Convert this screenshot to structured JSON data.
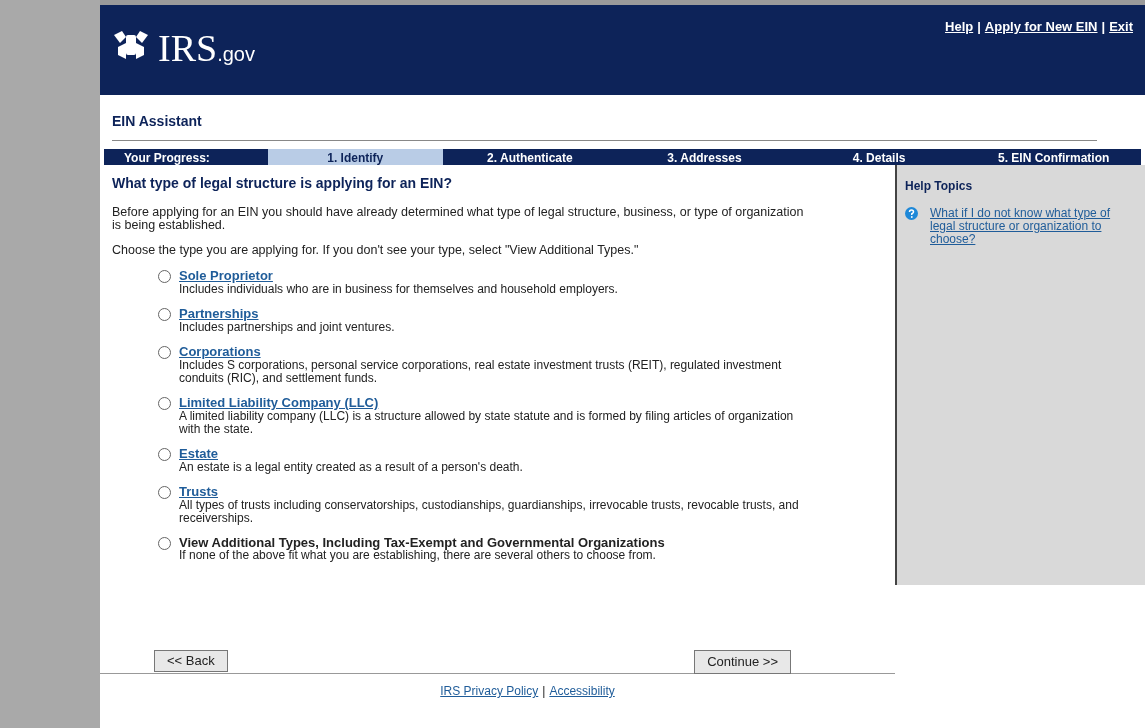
{
  "header": {
    "logo_main": "IRS",
    "logo_suffix": ".gov",
    "links": [
      {
        "label": "Help"
      },
      {
        "label": "Apply for New EIN"
      },
      {
        "label": "Exit"
      }
    ],
    "separator": "|"
  },
  "page_title": "EIN Assistant",
  "progress": {
    "label": "Your Progress:",
    "steps": [
      {
        "label": "1. Identify",
        "selected": true
      },
      {
        "label": "2. Authenticate",
        "selected": false
      },
      {
        "label": "3. Addresses",
        "selected": false
      },
      {
        "label": "4. Details",
        "selected": false
      },
      {
        "label": "5. EIN Confirmation",
        "selected": false
      }
    ]
  },
  "question": "What type of legal structure is applying for an EIN?",
  "intro": [
    "Before applying for an EIN you should have already determined what type of legal structure, business, or type of organization is being established.",
    "Choose the type you are applying for. If you don't see your type, select \"View Additional Types.\""
  ],
  "options": [
    {
      "kind": "link",
      "title": "Sole Proprietor",
      "description": "Includes individuals who are in business for themselves and household employers.",
      "selected": false
    },
    {
      "kind": "link",
      "title": "Partnerships",
      "description": "Includes partnerships and joint ventures.",
      "selected": false
    },
    {
      "kind": "link",
      "title": "Corporations",
      "description": "Includes S corporations, personal service corporations, real estate investment trusts (REIT), regulated investment conduits (RIC), and settlement funds.",
      "selected": false
    },
    {
      "kind": "link",
      "title": "Limited Liability Company (LLC)",
      "description": "A limited liability company (LLC) is a structure allowed by state statute and is formed by filing articles of organization with the state.",
      "selected": false
    },
    {
      "kind": "link",
      "title": "Estate",
      "description": "An estate is a legal entity created as a result of a person's death.",
      "selected": false
    },
    {
      "kind": "link",
      "title": "Trusts",
      "description": "All types of trusts including conservatorships, custodianships, guardianships, irrevocable trusts, revocable trusts, and receiverships.",
      "selected": false
    },
    {
      "kind": "bold",
      "title": "View Additional Types, Including Tax-Exempt and Governmental Organizations",
      "description": "If none of the above fit what you are establishing, there are several others to choose from.",
      "selected": false
    }
  ],
  "help": {
    "title": "Help Topics",
    "topics": [
      {
        "label": "What if I do not know what type of legal structure or organization to choose?"
      }
    ]
  },
  "buttons": {
    "back": "<< Back",
    "continue": "Continue >>"
  },
  "footer": {
    "links": [
      {
        "label": "IRS Privacy Policy"
      },
      {
        "label": "Accessibility"
      }
    ],
    "separator": "|"
  }
}
